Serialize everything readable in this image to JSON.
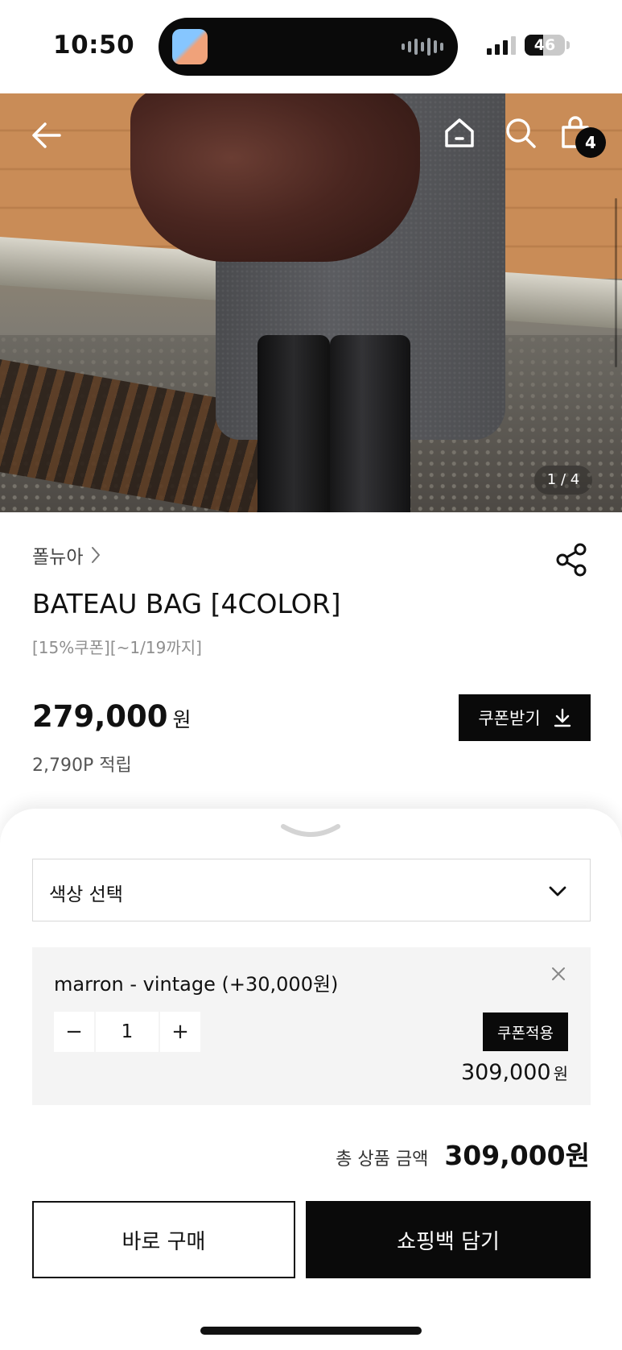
{
  "status_bar": {
    "time": "10:50",
    "battery_level": "46",
    "battery_fraction": 0.46,
    "signal_bars_active": 3,
    "signal_bars_total": 4
  },
  "hero": {
    "image_counter": "1 / 4",
    "icons": {
      "back": "arrow-left-icon",
      "home": "home-icon",
      "search": "search-icon",
      "cart": "shopping-bag-icon"
    },
    "cart_count": "4"
  },
  "product": {
    "brand": "폴뉴아",
    "name": "BATEAU BAG [4COLOR]",
    "subtitle": "[15%쿠폰][~1/19까지]",
    "price": "279,000",
    "price_unit": "원",
    "points": "2,790P 적립",
    "coupon_button": "쿠폰받기"
  },
  "option_sheet": {
    "select_label": "색상 선택",
    "selected_item": {
      "name": "marron - vintage (+30,000원)",
      "quantity": "1",
      "minus": "−",
      "plus": "+",
      "coupon_apply": "쿠폰적용",
      "price": "309,000",
      "price_unit": "원"
    },
    "total_label": "총 상품 금액",
    "total_value": "309,000원",
    "buy_now": "바로 구매",
    "add_to_cart": "쇼핑백 담기"
  },
  "colors": {
    "primary": "#0a0a0a",
    "card_bg": "#f4f4f4",
    "muted_text": "#8f8f8f"
  }
}
